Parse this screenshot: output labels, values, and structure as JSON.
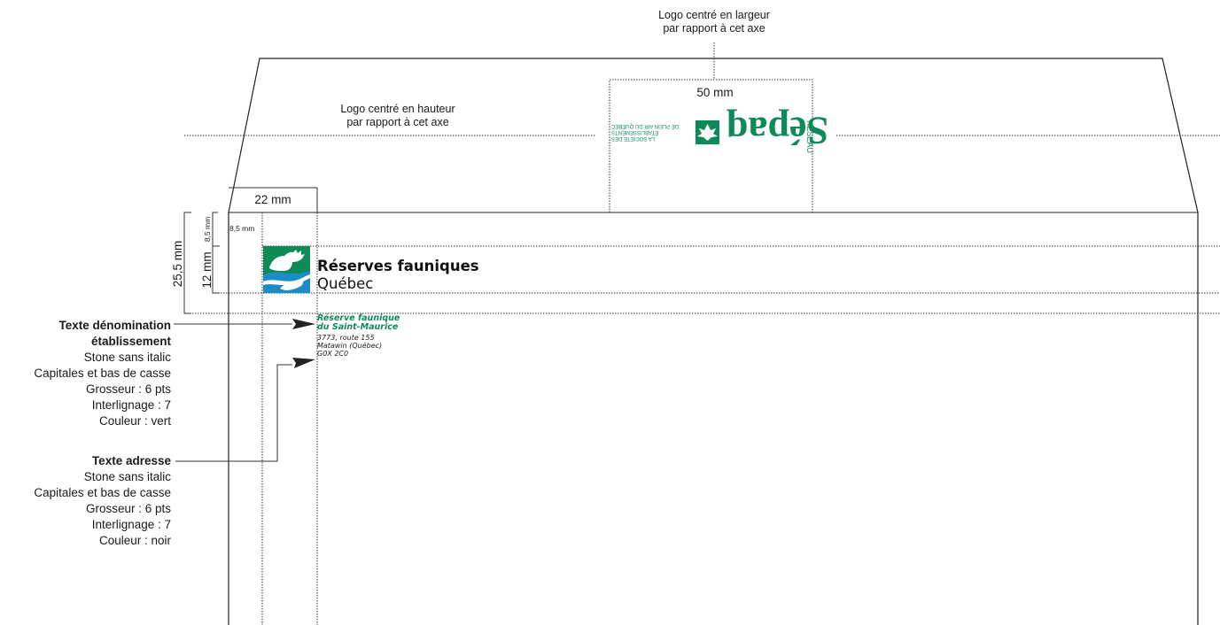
{
  "annotations": {
    "logo_width_axis": [
      "Logo centré en largeur",
      "par rapport à cet axe"
    ],
    "logo_height_axis": [
      "Logo centré en hauteur",
      "par rapport à cet axe"
    ],
    "flap_logo_width": "50 mm",
    "margin_width": "22 mm",
    "total_height": "25,5 mm",
    "logo_height": "12 mm",
    "top_offset_vertical": "8,5 mm",
    "top_offset_horizontal": "8,5 mm"
  },
  "brand": {
    "title": "Réserves fauniques",
    "subtitle": "Québec",
    "colors": {
      "green": "#0d8a57",
      "blue": "#1a8cc8",
      "white": "#ffffff"
    }
  },
  "address": {
    "name_line1": "Réserve faunique",
    "name_line2": "du Saint-Maurice",
    "street": "3773, route 155",
    "city": "Matawin (Québec)",
    "postal": "G0X 2C0"
  },
  "sepaq_logo": {
    "small_lines": [
      "LA SOCIÉTÉ DES",
      "ÉTABLISSEMENTS",
      "DE PLEIN AIR DU QUÉBEC"
    ],
    "word": "Sépaq",
    "reseau": "RÉSEAU",
    "color": "#0d8a57"
  },
  "spec_denomination": {
    "title_line1": "Texte dénomination",
    "title_line2": "établissement",
    "font": "Stone sans italic",
    "case": "Capitales et bas de casse",
    "size": "Grosseur : 6 pts",
    "leading": "Interlignage : 7",
    "color": "Couleur : vert"
  },
  "spec_address": {
    "title": "Texte adresse",
    "font": "Stone sans italic",
    "case": "Capitales et bas de casse",
    "size": "Grosseur : 6 pts",
    "leading": "Interlignage : 7",
    "color": "Couleur : noir"
  }
}
